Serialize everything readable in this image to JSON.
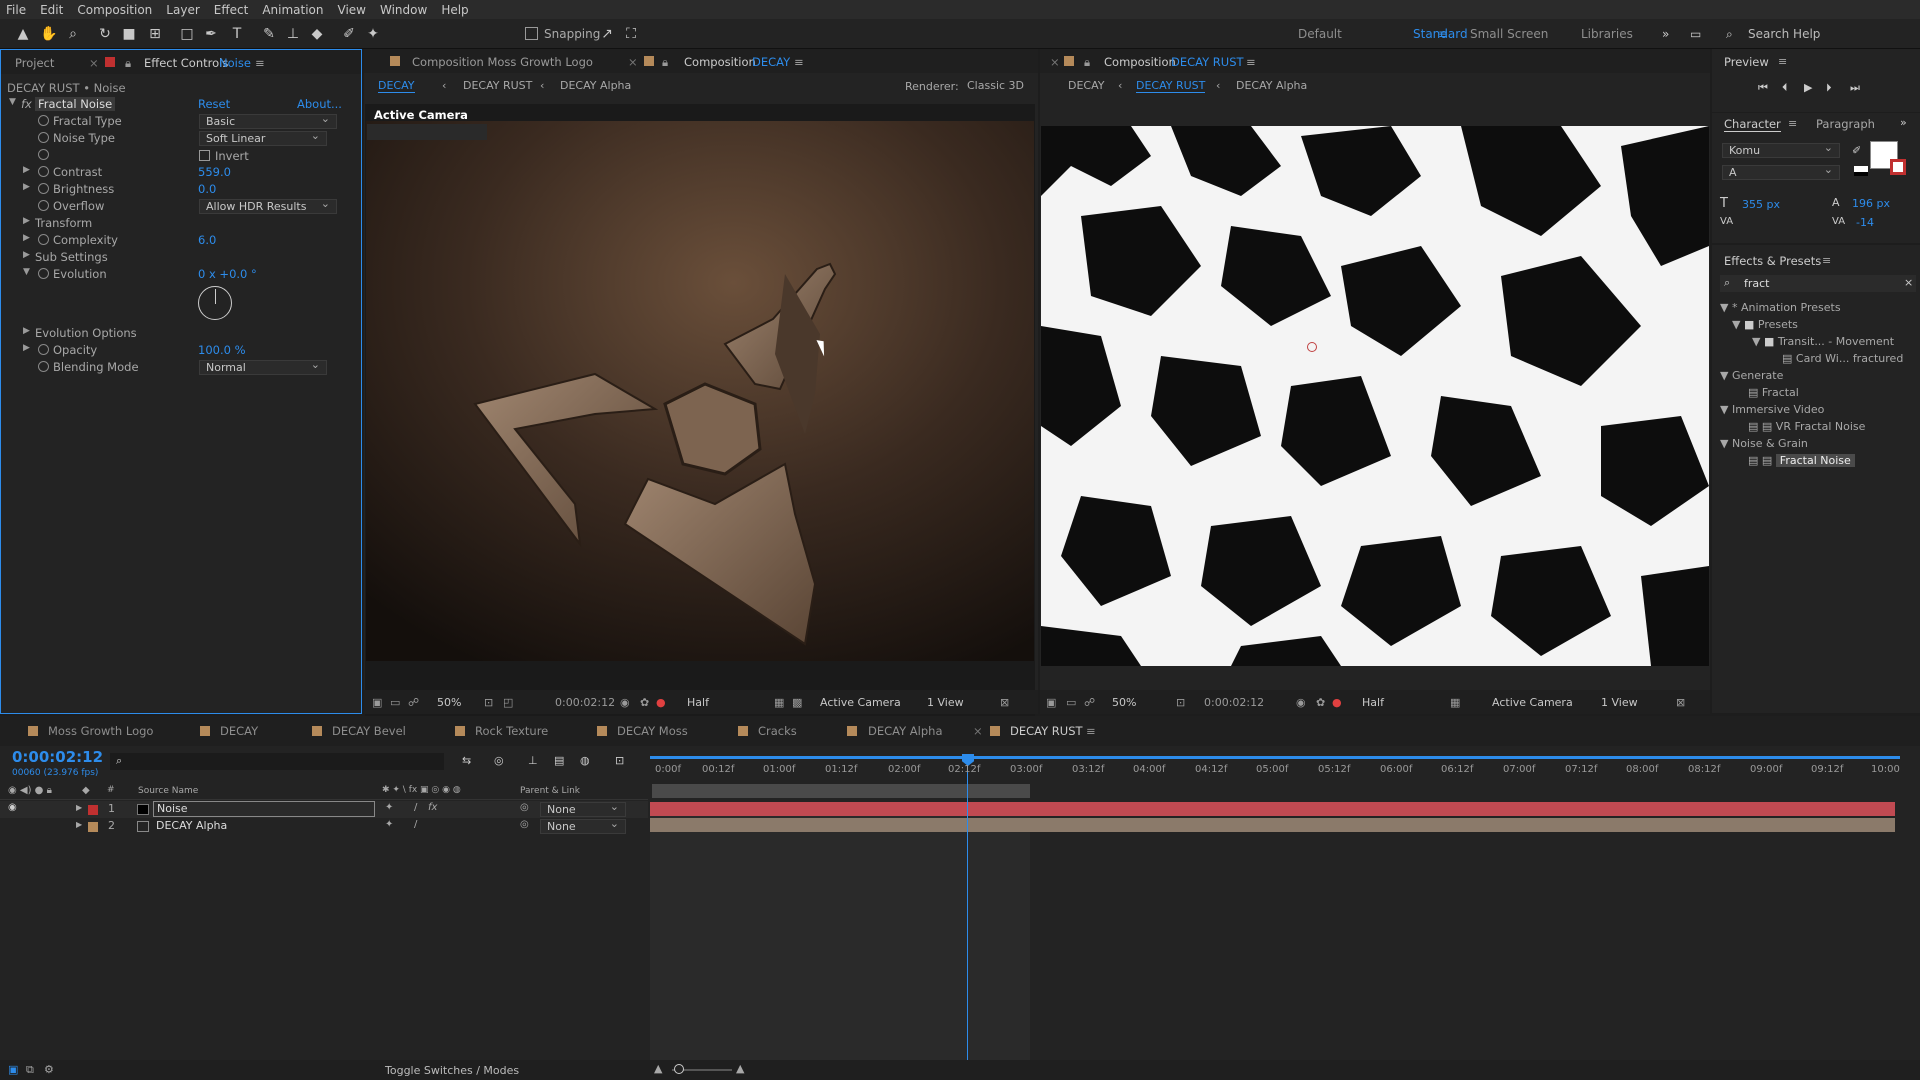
{
  "menu": [
    "File",
    "Edit",
    "Composition",
    "Layer",
    "Effect",
    "Animation",
    "View",
    "Window",
    "Help"
  ],
  "toolbar": {
    "snapping": "Snapping",
    "workspaces": [
      "Default",
      "Standard",
      "Small Screen",
      "Libraries"
    ],
    "search_placeholder": "Search Help"
  },
  "project_panel": {
    "tab_project": "Project",
    "tab_effect_controls": "Effect Controls",
    "layer_name": "Noise",
    "title": "DECAY RUST • Noise",
    "effect_name": "Fractal Noise",
    "reset": "Reset",
    "about": "About...",
    "props": {
      "fractal_type": "Fractal Type",
      "fractal_type_val": "Basic",
      "noise_type": "Noise Type",
      "noise_type_val": "Soft Linear",
      "invert": "Invert",
      "contrast": "Contrast",
      "contrast_val": "559.0",
      "brightness": "Brightness",
      "brightness_val": "0.0",
      "overflow": "Overflow",
      "overflow_val": "Allow HDR Results",
      "transform": "Transform",
      "complexity": "Complexity",
      "complexity_val": "6.0",
      "sub_settings": "Sub Settings",
      "evolution": "Evolution",
      "evolution_val": "0 x +0.0 °",
      "evolution_options": "Evolution Options",
      "opacity": "Opacity",
      "opacity_val": "100.0 %",
      "blending_mode": "Blending Mode",
      "blending_mode_val": "Normal"
    }
  },
  "comp_left": {
    "tab1": "Composition Moss Growth Logo",
    "tab2_prefix": "Composition",
    "tab2_name": "DECAY",
    "crumbs": [
      "DECAY",
      "DECAY RUST",
      "DECAY Alpha"
    ],
    "renderer_label": "Renderer:",
    "renderer_val": "Classic 3D",
    "active_camera": "Active Camera",
    "footer": {
      "zoom": "50%",
      "time": "0:00:02:12",
      "res": "Half",
      "camera": "Active Camera",
      "views": "1 View"
    }
  },
  "comp_right": {
    "tab_prefix": "Composition",
    "tab_name": "DECAY RUST",
    "crumbs": [
      "DECAY",
      "DECAY RUST",
      "DECAY Alpha"
    ],
    "footer": {
      "zoom": "50%",
      "time": "0:00:02:12",
      "res": "Half",
      "camera": "Active Camera",
      "views": "1 View"
    }
  },
  "right_panel": {
    "preview": "Preview",
    "character": "Character",
    "paragraph": "Paragraph",
    "font": "Komu",
    "style": "A",
    "font_size": "355 px",
    "leading": "196 px",
    "tracking": "-14",
    "effects_presets": "Effects & Presets",
    "search": "fract",
    "tree": [
      "Animation Presets",
      "Presets",
      "Transit... - Movement",
      "Card Wi... fractured",
      "Generate",
      "Fractal",
      "Immersive Video",
      "VR Fractal Noise",
      "Noise & Grain",
      "Fractal Noise"
    ]
  },
  "timeline": {
    "tabs": [
      "Moss Growth Logo",
      "DECAY",
      "DECAY Bevel",
      "Rock Texture",
      "DECAY Moss",
      "Cracks",
      "DECAY Alpha",
      "DECAY RUST"
    ],
    "current_time": "0:00:02:12",
    "frame_info": "00060 (23.976 fps)",
    "col_source": "Source Name",
    "col_parent": "Parent & Link",
    "layers": [
      {
        "num": "1",
        "name": "Noise",
        "parent": "None"
      },
      {
        "num": "2",
        "name": "DECAY Alpha",
        "parent": "None"
      }
    ],
    "ruler": [
      "0:00f",
      "00:12f",
      "01:00f",
      "01:12f",
      "02:00f",
      "02:12f",
      "03:00f",
      "03:12f",
      "04:00f",
      "04:12f",
      "05:00f",
      "05:12f",
      "06:00f",
      "06:12f",
      "07:00f",
      "07:12f",
      "08:00f",
      "08:12f",
      "09:00f",
      "09:12f",
      "10:00"
    ],
    "toggle": "Toggle Switches / Modes"
  },
  "colors": {
    "accent": "#2d8ceb",
    "layer_red": "#c04a52",
    "layer_tan": "#8b7a6a"
  }
}
